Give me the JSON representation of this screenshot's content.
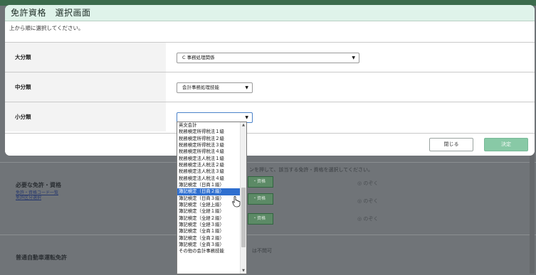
{
  "modal": {
    "title": "免許資格　選択画面",
    "instruction": "上から順に選択してください。",
    "rows": [
      {
        "label": "大分類",
        "value": "C 事務処理関係"
      },
      {
        "label": "中分類",
        "value": "会計事務処理技能"
      },
      {
        "label": "小分類",
        "value": ""
      }
    ],
    "buttons": {
      "close": "閉じる",
      "ok": "決定"
    }
  },
  "dropdown": {
    "selected_index": 10,
    "options": [
      "英文会計",
      "税務検定所得税法１級",
      "税務検定所得税法２級",
      "税務検定所得税法３級",
      "税務検定所得税法４級",
      "税務検定法人税法１級",
      "税務検定法人税法２級",
      "税務検定法人税法３級",
      "税務検定法人税法４級",
      "簿記検定（日商１級）",
      "簿記検定（日商２級）",
      "簿記検定（日商３級）",
      "簿記検定（全経上級）",
      "簿記検定（全経１級）",
      "簿記検定（全経２級）",
      "簿記検定（全経３級）",
      "簿記検定（全商１級）",
      "簿記検定（全商２級）",
      "簿記検定（全商３級）",
      "その他の会計事務技能"
    ]
  },
  "background": {
    "required_label": "必要な免許・資格",
    "links": [
      "免許・資格コード一覧",
      "免許区分選択"
    ],
    "hint": "ンを押して、該当する免許・資格を選択してください。",
    "pill_label": "・資格",
    "exclude_label": "のぞく",
    "driver_label": "普通自動車運転免許",
    "driver_note": "は不問可"
  }
}
